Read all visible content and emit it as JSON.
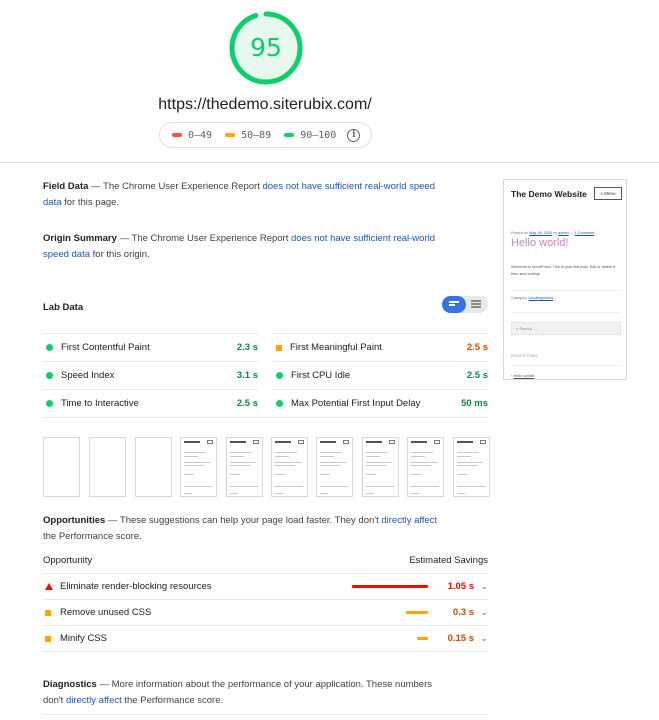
{
  "score": {
    "value": "95",
    "color": "#0cce6b",
    "fraction": 0.95
  },
  "url": "https://thedemo.siterubix.com/",
  "legend": [
    {
      "label": "0–49",
      "color": "#ff4e42"
    },
    {
      "label": "50–89",
      "color": "#ffa400"
    },
    {
      "label": "90–100",
      "color": "#0cce6b"
    }
  ],
  "legend_info_icon": "i",
  "field_data": {
    "title": "Field Data",
    "dash": "— The Chrome User Experience Report ",
    "link": "does not have sufficient real-world speed data",
    "tail": " for this page."
  },
  "origin_summary": {
    "title": "Origin Summary",
    "dash": "— The Chrome User Experience Report ",
    "link": "does not have sufficient real-world speed data",
    "tail": " for this origin."
  },
  "lab_data": {
    "title": "Lab Data",
    "metrics": [
      {
        "label": "First Contentful Paint",
        "value": "2.3 s",
        "status": "pass"
      },
      {
        "label": "First Meaningful Paint",
        "value": "2.5 s",
        "status": "average"
      },
      {
        "label": "Speed Index",
        "value": "3.1 s",
        "status": "pass"
      },
      {
        "label": "First CPU Idle",
        "value": "2.5 s",
        "status": "pass"
      },
      {
        "label": "Time to Interactive",
        "value": "2.5 s",
        "status": "pass"
      },
      {
        "label": "Max Potential First Input Delay",
        "value": "50 ms",
        "status": "pass"
      }
    ]
  },
  "opportunities": {
    "title": "Opportunities",
    "dash": "— These suggestions can help your page load faster. They don't ",
    "link": "directly affect",
    "tail": " the Performance score.",
    "col_left": "Opportunity",
    "col_right": "Estimated Savings",
    "items": [
      {
        "label": "Eliminate render-blocking resources",
        "savings": "1.05 s",
        "status": "fail",
        "bar_fraction": 1.0,
        "color": "#eb0f00"
      },
      {
        "label": "Remove unused CSS",
        "savings": "0.3 s",
        "status": "average",
        "bar_fraction": 0.29,
        "color": "#ffa400"
      },
      {
        "label": "Minify CSS",
        "savings": "0.15 s",
        "status": "average",
        "bar_fraction": 0.15,
        "color": "#ffa400"
      }
    ],
    "chevron": "⌄"
  },
  "diagnostics": {
    "title": "Diagnostics",
    "dash": "— More information about the performance of your application. These numbers don't ",
    "link": "directly affect",
    "tail": " the Performance score."
  },
  "final_screenshot": {
    "site_title": "The Demo Website",
    "menu_label": "≡ Menu",
    "meta_prefix": "Posted on ",
    "meta_date": "May 18, 2020",
    "meta_by": " by ",
    "meta_author": "admin",
    "meta_sep": " — ",
    "meta_comments": "1 Comment",
    "post_title": "Hello world!",
    "post_body": "Welcome to WordPress. This is your first post. Edit or delete it, then start writing!",
    "category_prefix": "Category: ",
    "category": "Uncategorized",
    "search_placeholder": "Search …",
    "recent_posts": "Recent Posts",
    "recent_item": "Hello world!"
  }
}
